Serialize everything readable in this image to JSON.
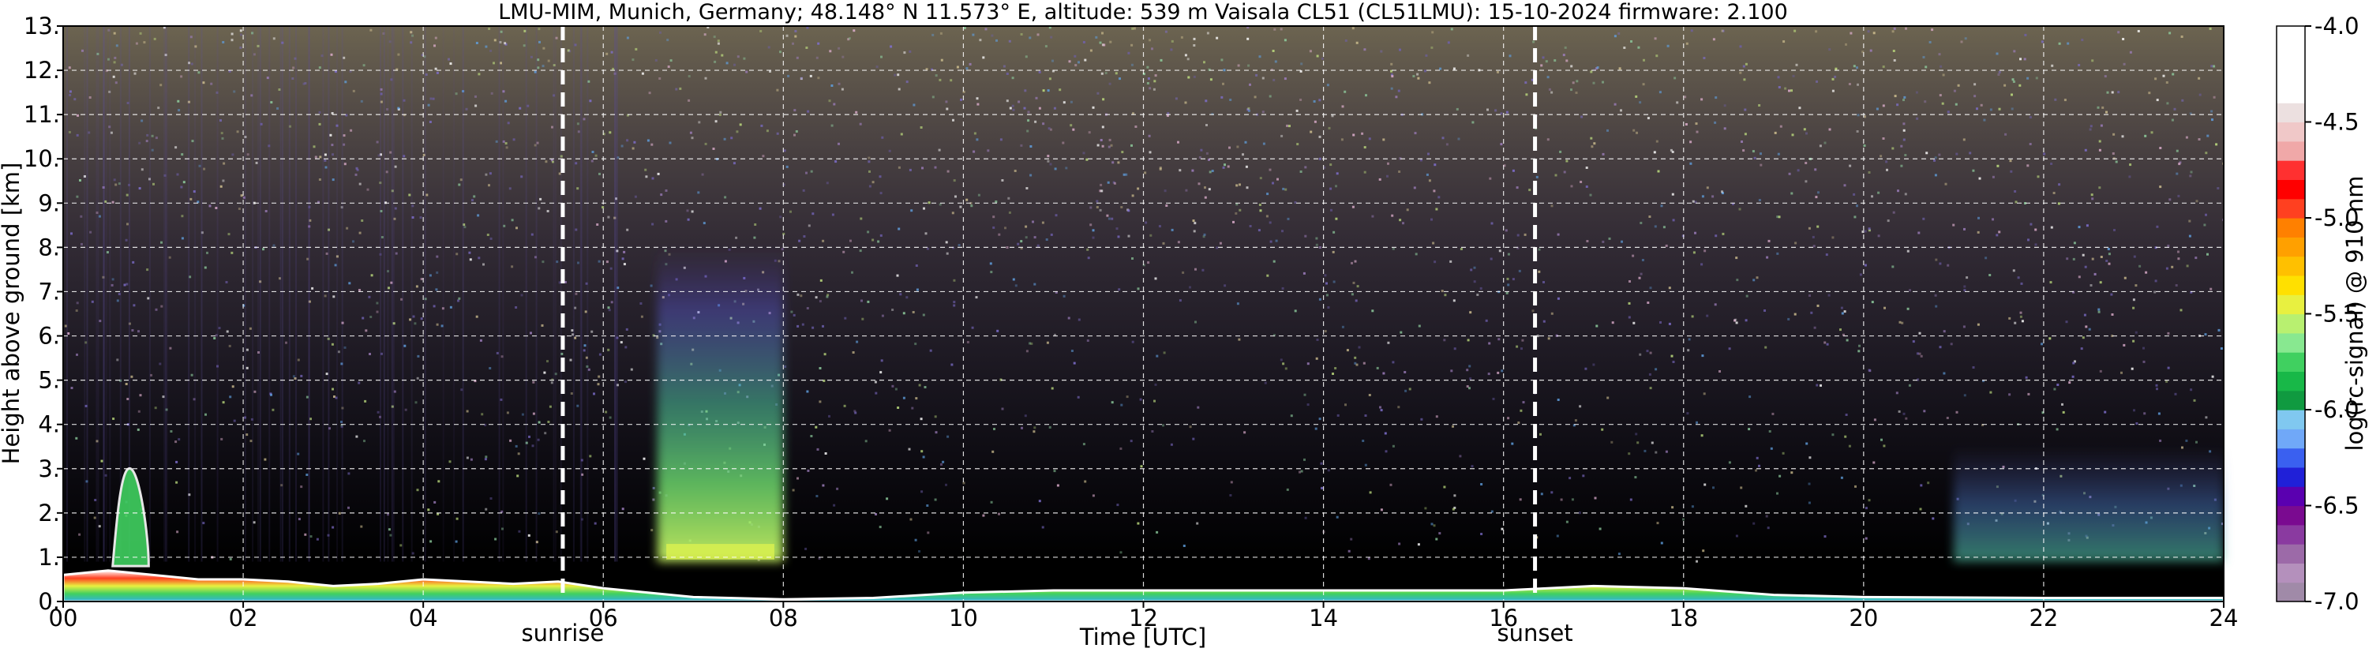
{
  "chart_data": {
    "type": "heatmap",
    "title": "LMU-MIM, Munich, Germany; 48.148° N 11.573° E, altitude: 539 m    Vaisala CL51 (CL51LMU): 15-10-2024    firmware: 2.100",
    "xlabel": "Time [UTC]",
    "ylabel": "Height above ground [km]",
    "xlim": [
      0,
      24
    ],
    "ylim": [
      0,
      13
    ],
    "x_ticks": [
      0,
      2,
      4,
      6,
      8,
      10,
      12,
      14,
      16,
      18,
      20,
      22,
      24
    ],
    "x_tick_labels": [
      "00",
      "02",
      "04",
      "06",
      "08",
      "10",
      "12",
      "14",
      "16",
      "18",
      "20",
      "22",
      "24"
    ],
    "y_ticks": [
      0,
      1,
      2,
      3,
      4,
      5,
      6,
      7,
      8,
      9,
      10,
      11,
      12,
      13
    ],
    "y_tick_labels": [
      "0.",
      "1.",
      "2.",
      "3.",
      "4.",
      "5.",
      "6.",
      "7.",
      "8.",
      "9.",
      "10.",
      "11.",
      "12.",
      "13."
    ],
    "grid": true,
    "annotations": [
      {
        "label": "sunrise",
        "time": 5.55
      },
      {
        "label": "sunset",
        "time": 16.35
      }
    ],
    "colorbar": {
      "label": "log(rc-signal) @ 910 nm",
      "range": [
        -7.0,
        -4.0
      ],
      "ticks": [
        -7.0,
        -6.5,
        -6.0,
        -5.5,
        -5.0,
        -4.5,
        -4.0
      ],
      "tick_labels": [
        "-7.0",
        "-6.5",
        "-6.0",
        "-5.5",
        "-5.0",
        "-4.5",
        "-4.0"
      ],
      "colors": [
        "#a08aa8",
        "#b490bc",
        "#9c6aa8",
        "#8a3aa0",
        "#7a0a90",
        "#5a00b0",
        "#2020d8",
        "#3a60f0",
        "#70a8f8",
        "#80c8f0",
        "#109a40",
        "#18b848",
        "#40d060",
        "#88e890",
        "#b8f070",
        "#e8f040",
        "#ffe000",
        "#ffc000",
        "#ffa000",
        "#ff8000",
        "#ff4020",
        "#ff0000",
        "#ff3030",
        "#f0a8a8",
        "#f0c8c8",
        "#ece0e0",
        "#ffffff",
        "#ffffff",
        "#ffffff",
        "#ffffff"
      ]
    },
    "features": {
      "boundary_layer_top_km": [
        {
          "time": 0,
          "height": 0.6
        },
        {
          "time": 0.5,
          "height": 0.7
        },
        {
          "time": 1,
          "height": 0.6
        },
        {
          "time": 1.5,
          "height": 0.5
        },
        {
          "time": 2,
          "height": 0.5
        },
        {
          "time": 2.5,
          "height": 0.45
        },
        {
          "time": 3,
          "height": 0.35
        },
        {
          "time": 3.5,
          "height": 0.4
        },
        {
          "time": 4,
          "height": 0.5
        },
        {
          "time": 4.5,
          "height": 0.45
        },
        {
          "time": 5,
          "height": 0.4
        },
        {
          "time": 5.5,
          "height": 0.45
        },
        {
          "time": 6,
          "height": 0.3
        },
        {
          "time": 7,
          "height": 0.1
        },
        {
          "time": 8,
          "height": 0.05
        },
        {
          "time": 9,
          "height": 0.08
        },
        {
          "time": 10,
          "height": 0.2
        },
        {
          "time": 11,
          "height": 0.25
        },
        {
          "time": 12,
          "height": 0.25
        },
        {
          "time": 13,
          "height": 0.25
        },
        {
          "time": 14,
          "height": 0.25
        },
        {
          "time": 15,
          "height": 0.25
        },
        {
          "time": 16,
          "height": 0.25
        },
        {
          "time": 17,
          "height": 0.35
        },
        {
          "time": 18,
          "height": 0.3
        },
        {
          "time": 19,
          "height": 0.15
        },
        {
          "time": 20,
          "height": 0.1
        },
        {
          "time": 22,
          "height": 0.08
        },
        {
          "time": 24,
          "height": 0.08
        }
      ],
      "elevated_layer": {
        "time_start": 0.55,
        "time_end": 0.95,
        "height_top_km": 3.1
      },
      "aerosol_plume": {
        "time_start": 6.6,
        "time_end": 8.0,
        "height_bottom_km": 0.9,
        "height_top_km": 8.0
      },
      "night_aerosol_band": {
        "time_start": 21.0,
        "time_end": 24.0,
        "height_bottom_km": 0.9,
        "height_top_km": 3.5
      }
    }
  }
}
